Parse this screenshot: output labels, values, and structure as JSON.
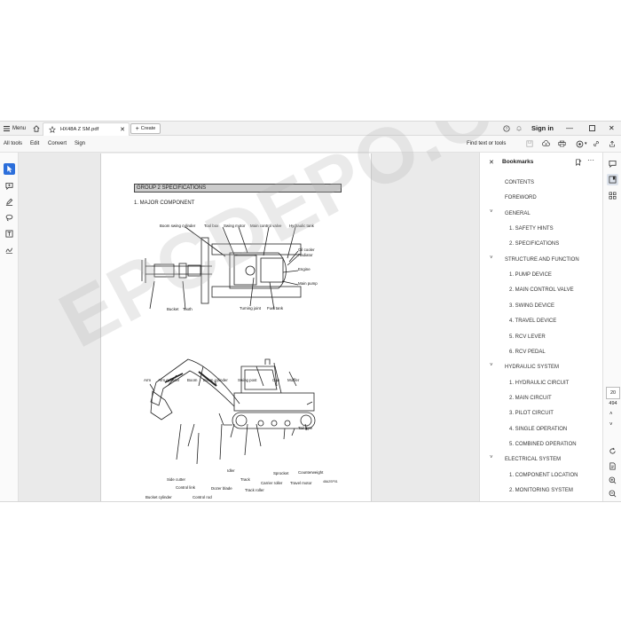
{
  "titlebar": {
    "menu_label": "Menu",
    "tab_title": "HX48A Z SM.pdf",
    "create_label": "Create",
    "sign_in": "Sign in"
  },
  "menubar": {
    "items": [
      "All tools",
      "Edit",
      "Convert",
      "Sign"
    ],
    "find_text": "Find text or tools"
  },
  "document": {
    "section_title": "GROUP 2  SPECIFICATIONS",
    "subsection_title": "1.  MAJOR COMPONENT",
    "labels_top": {
      "boom_swing_cylinder": "Boom swing cylinder",
      "tool_box": "Tool box",
      "swing_motor": "Swing motor",
      "main_control_valve": "Main control valve",
      "hydraulic_tank": "Hydraulic tank",
      "oil_cooler": "Oil cooler",
      "radiator": "Radiator",
      "engine": "Engine",
      "main_pump": "Main pump",
      "bucket": "Bucket",
      "tooth": "Tooth",
      "turning_joint": "Turning joint",
      "fuel_tank": "Fuel tank"
    },
    "labels_side": {
      "arm": "Arm",
      "arm_cylinder": "Arm cylinder",
      "boom": "Boom",
      "boom_cylinder": "Boom cylinder",
      "swing_post": "Swing post",
      "cab": "Cab",
      "muffler": "Muffler",
      "tail_pipe": "Tail pipe",
      "counterweight": "Counterweight",
      "sprocket": "Sprocket",
      "travel_motor": "Travel motor",
      "carrier_roller": "Carrier roller",
      "track": "Track",
      "track_roller": "Track roller",
      "idler": "Idler",
      "dozer_blade": "Dozer blade",
      "side_cutter": "Side cutter",
      "control_link": "Control link",
      "control_rod": "Control rod",
      "bucket_cylinder": "Bucket cylinder"
    },
    "code": "48A2SP01",
    "watermark": "EPCDEPO.COM"
  },
  "bookmarks": {
    "title": "Bookmarks",
    "items": [
      {
        "label": "CONTENTS",
        "level": 0,
        "chevron": false
      },
      {
        "label": "FOREWORD",
        "level": 0,
        "chevron": false
      },
      {
        "label": "GENERAL",
        "level": 0,
        "chevron": true
      },
      {
        "label": "1. SAFETY HINTS",
        "level": 1,
        "chevron": false
      },
      {
        "label": "2. SPECIFICATIONS",
        "level": 1,
        "chevron": false
      },
      {
        "label": "STRUCTURE AND FUNCTION",
        "level": 0,
        "chevron": true
      },
      {
        "label": "1. PUMP DEVICE",
        "level": 1,
        "chevron": false
      },
      {
        "label": "2. MAIN CONTROL VALVE",
        "level": 1,
        "chevron": false
      },
      {
        "label": "3. SWING DEVICE",
        "level": 1,
        "chevron": false
      },
      {
        "label": "4. TRAVEL DEVICE",
        "level": 1,
        "chevron": false
      },
      {
        "label": "5. RCV LEVER",
        "level": 1,
        "chevron": false
      },
      {
        "label": "6. RCV PEDAL",
        "level": 1,
        "chevron": false
      },
      {
        "label": "HYDRAULIC SYSTEM",
        "level": 0,
        "chevron": true
      },
      {
        "label": "1. HYDRAULIC CIRCUIT",
        "level": 1,
        "chevron": false
      },
      {
        "label": "2. MAIN CIRCUIT",
        "level": 1,
        "chevron": false
      },
      {
        "label": "3. PILOT CIRCUIT",
        "level": 1,
        "chevron": false
      },
      {
        "label": "4. SINGLE OPERATION",
        "level": 1,
        "chevron": false
      },
      {
        "label": "5. COMBINED OPERATION",
        "level": 1,
        "chevron": false
      },
      {
        "label": "ELECTRICAL SYSTEM",
        "level": 0,
        "chevron": true
      },
      {
        "label": "1. COMPONENT LOCATION",
        "level": 1,
        "chevron": false
      },
      {
        "label": "2. MONITORING SYSTEM",
        "level": 1,
        "chevron": false
      }
    ]
  },
  "page_nav": {
    "current_page": "20",
    "total_pages": "494"
  },
  "colors": {
    "accent": "#2c6fdb",
    "section_bg": "#cccccc"
  }
}
